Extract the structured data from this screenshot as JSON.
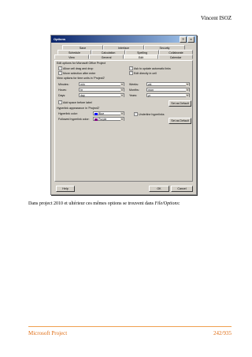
{
  "header": {
    "author": "Vincent ISOZ"
  },
  "footer": {
    "left": "Microsoft Project",
    "right": "242/935"
  },
  "caption": {
    "text": "Dans project 2010 et ultérieur ces mêmes options se trouvent dans ",
    "menu": "File/Options",
    "end": ":"
  },
  "dialog": {
    "title": "Options",
    "tabs_row1": [
      "Save",
      "Interface",
      "Security"
    ],
    "tabs_row2": [
      "Schedule",
      "Calculation",
      "Spelling",
      "Collaborate"
    ],
    "tabs_row3": [
      "View",
      "General",
      "Edit",
      "Calendar"
    ],
    "edit_section": "Edit options for Microsoft Office Project",
    "opt_drag": "Allow cell drag and drop",
    "opt_move": "Move selection after enter",
    "opt_ask": "Ask to update automatic links",
    "opt_direct": "Edit directly in cell",
    "units_section": "View options for time units in 'Project2'",
    "minutes_label": "Minutes:",
    "minutes_val": "min",
    "hours_label": "Hours:",
    "hours_val": "hr",
    "days_label": "Days:",
    "days_val": "day",
    "weeks_label": "Weeks:",
    "weeks_val": "wk",
    "months_label": "Months:",
    "months_val": "mon",
    "years_label": "Years:",
    "years_val": "yr",
    "opt_space": "Add space before label",
    "set_default": "Set as Default",
    "hyperlink_section": "Hyperlink appearance in 'Project2'",
    "hyper_color_label": "Hyperlink color:",
    "hyper_color_val": "Blue",
    "followed_label": "Followed hyperlink color:",
    "followed_val": "Purple",
    "opt_underline": "Underline hyperlinks",
    "help": "Help",
    "ok": "OK",
    "cancel": "Cancel",
    "colors": {
      "blue": "#0000ff",
      "purple": "#800080"
    }
  }
}
